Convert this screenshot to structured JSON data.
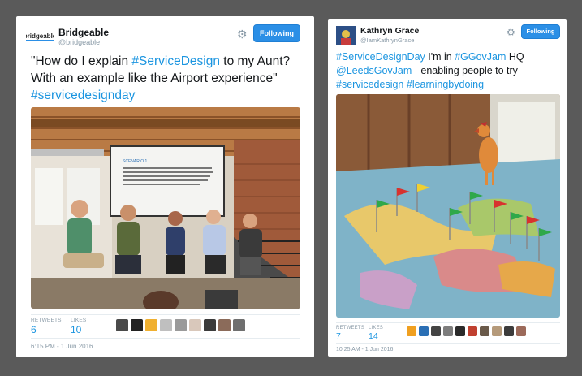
{
  "tweet1": {
    "avatar_label": "bridgeable",
    "name": "Bridgeable",
    "handle": "@bridgeable",
    "follow_label": "Following",
    "text_plain1": "\"How do I explain ",
    "text_tag1": "#ServiceDesign",
    "text_plain2": " to my Aunt? With an example like the Airport experience\" ",
    "text_tag2": "#servicedesignday",
    "slide_title": "SCENARIO 1",
    "slide_body": "You are in a family gathering. You are talking to an aunt (someone who's more familiar with the world of traditional jobs but she's never ex-explanation e.g. doctor, teacher). She asks, \"Oh, what do you do? ... What does it take to do what you do? What does that mean? What are some examples of service design?\"",
    "retweets_label": "RETWEETS",
    "retweets": "6",
    "likes_label": "LIKES",
    "likes": "10",
    "timestamp": "6:15 PM - 1 Jun 2016",
    "liker_colors": [
      "#4a4a4a",
      "#222222",
      "#f0b030",
      "#bfbfbf",
      "#9a9a9a",
      "#d9c8bb",
      "#3b3b3b",
      "#8b6b5a",
      "#6f6f6f"
    ]
  },
  "tweet2": {
    "name": "Kathryn Grace",
    "handle": "@IamKathrynGrace",
    "follow_label": "Following",
    "text_tag1": "#ServiceDesignDay",
    "text_plain1": " I'm in ",
    "text_tag2": "#GGovJam",
    "text_plain2": " HQ ",
    "text_tag3": "@LeedsGovJam",
    "text_plain3": " - enabling people to try ",
    "text_tag4": "#servicedesign",
    "text_plain4": " ",
    "text_tag5": "#learningbydoing",
    "retweets_label": "RETWEETS",
    "retweets": "7",
    "likes_label": "LIKES",
    "likes": "14",
    "timestamp": "10:25 AM - 1 Jun 2016",
    "liker_colors": [
      "#f0a020",
      "#2a6fb5",
      "#444444",
      "#7d7d7d",
      "#2a2a2a",
      "#c04030",
      "#6a5a4a",
      "#b59a7a",
      "#3c3c3c",
      "#9c6a5a"
    ]
  },
  "colors": {
    "accent": "#1b95e0",
    "follow_bg": "#2b8fe6",
    "page_bg": "#5a5a5a"
  }
}
